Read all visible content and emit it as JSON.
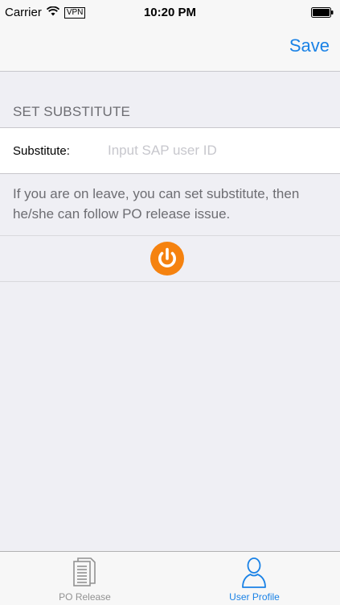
{
  "status_bar": {
    "carrier": "Carrier",
    "vpn": "VPN",
    "time": "10:20 PM"
  },
  "nav": {
    "save_label": "Save"
  },
  "section": {
    "header": "SET SUBSTITUTE",
    "substitute_label": "Substitute:",
    "substitute_value": "",
    "substitute_placeholder": "Input SAP user ID",
    "footer_note": "If you are on leave, you can set substitute, then he/she can follow PO release issue."
  },
  "power_button": {
    "icon": "power-icon",
    "color": "#f5820f"
  },
  "tab_bar": {
    "tabs": [
      {
        "label": "PO Release",
        "icon": "document-icon",
        "active": false
      },
      {
        "label": "User Profile",
        "icon": "user-icon",
        "active": true
      }
    ],
    "active_color": "#1a82e6",
    "inactive_color": "#929292"
  }
}
